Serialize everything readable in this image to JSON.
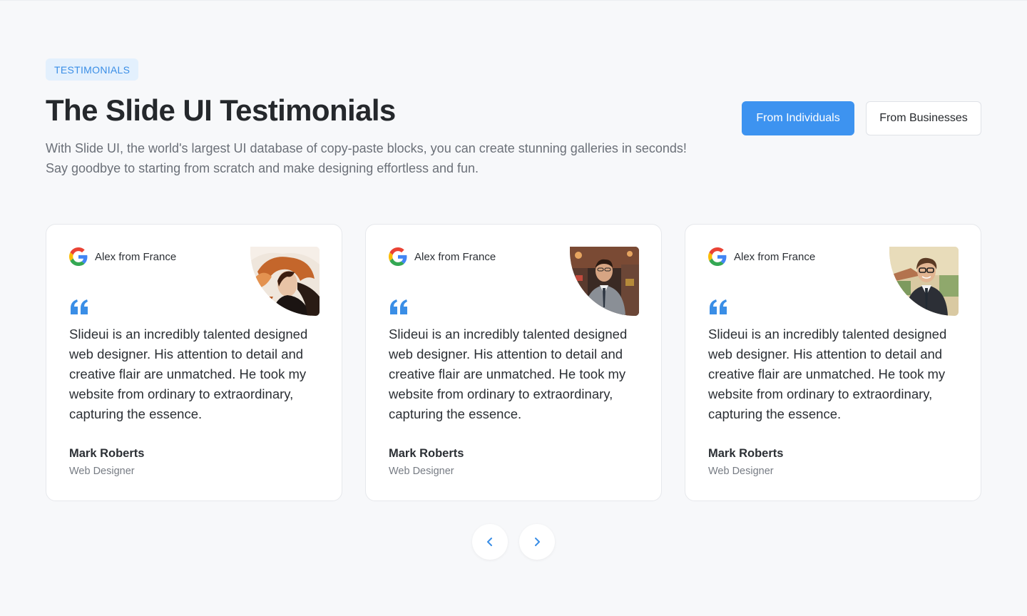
{
  "badge": "TESTIMONIALS",
  "title": "The Slide UI Testimonials",
  "subtitle": "With Slide UI, the world's largest UI database of copy-paste blocks, you can create stunning galleries in seconds! Say goodbye to starting from scratch and make designing effortless and fun.",
  "toggle": {
    "individuals_label": "From Individuals",
    "businesses_label": "From Businesses",
    "active": "individuals"
  },
  "cards": [
    {
      "source_icon": "google-icon",
      "reviewer": "Alex from France",
      "photo": "woman-portrait",
      "quote": "Slideui is an incredibly talented designed web designer. His attention to detail and creative flair are unmatched. He took my website from ordinary to extraordinary, capturing the essence.",
      "author": "Mark Roberts",
      "role": "Web Designer"
    },
    {
      "source_icon": "google-icon",
      "reviewer": "Alex from France",
      "photo": "man-suit-portrait",
      "quote": "Slideui is an incredibly talented designed web designer. His attention to detail and creative flair are unmatched. He took my website from ordinary to extraordinary, capturing the essence.",
      "author": "Mark Roberts",
      "role": "Web Designer"
    },
    {
      "source_icon": "google-icon",
      "reviewer": "Alex from France",
      "photo": "man-glasses-portrait",
      "quote": "Slideui is an incredibly talented designed web designer. His attention to detail and creative flair are unmatched. He took my website from ordinary to extraordinary, capturing the essence.",
      "author": "Mark Roberts",
      "role": "Web Designer"
    }
  ],
  "nav": {
    "prev_icon": "chevron-left-icon",
    "next_icon": "chevron-right-icon"
  },
  "colors": {
    "accent": "#3d93f0",
    "badge_bg": "#e3f0fd",
    "quote_mark": "#3a8ee6",
    "background": "#f7f8fa"
  }
}
